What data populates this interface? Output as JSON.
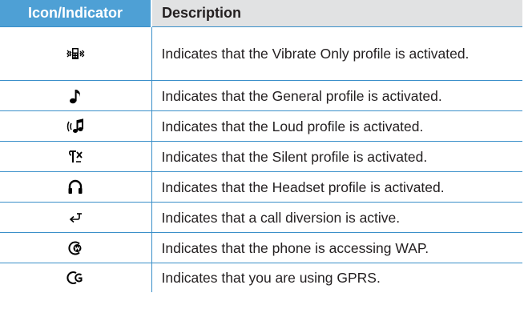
{
  "table": {
    "headers": [
      "Icon/Indicator",
      "Description"
    ],
    "header_color": "#4ea0d5",
    "rows": [
      {
        "icon": "vibrate-only-icon",
        "description": "Indicates that the Vibrate Only profile is activated."
      },
      {
        "icon": "music-note-icon",
        "description": "Indicates that the General profile is activated."
      },
      {
        "icon": "loud-profile-icon",
        "description": "Indicates that the Loud profile is activated."
      },
      {
        "icon": "silent-profile-icon",
        "description": "Indicates that the Silent profile is activated."
      },
      {
        "icon": "headset-icon",
        "description": "Indicates that the Headset profile is activated."
      },
      {
        "icon": "call-diversion-icon",
        "description": "Indicates that a call diversion is active."
      },
      {
        "icon": "wap-icon",
        "description": "Indicates that the phone is accessing WAP."
      },
      {
        "icon": "gprs-icon",
        "description": "Indicates that you are using GPRS."
      }
    ]
  }
}
